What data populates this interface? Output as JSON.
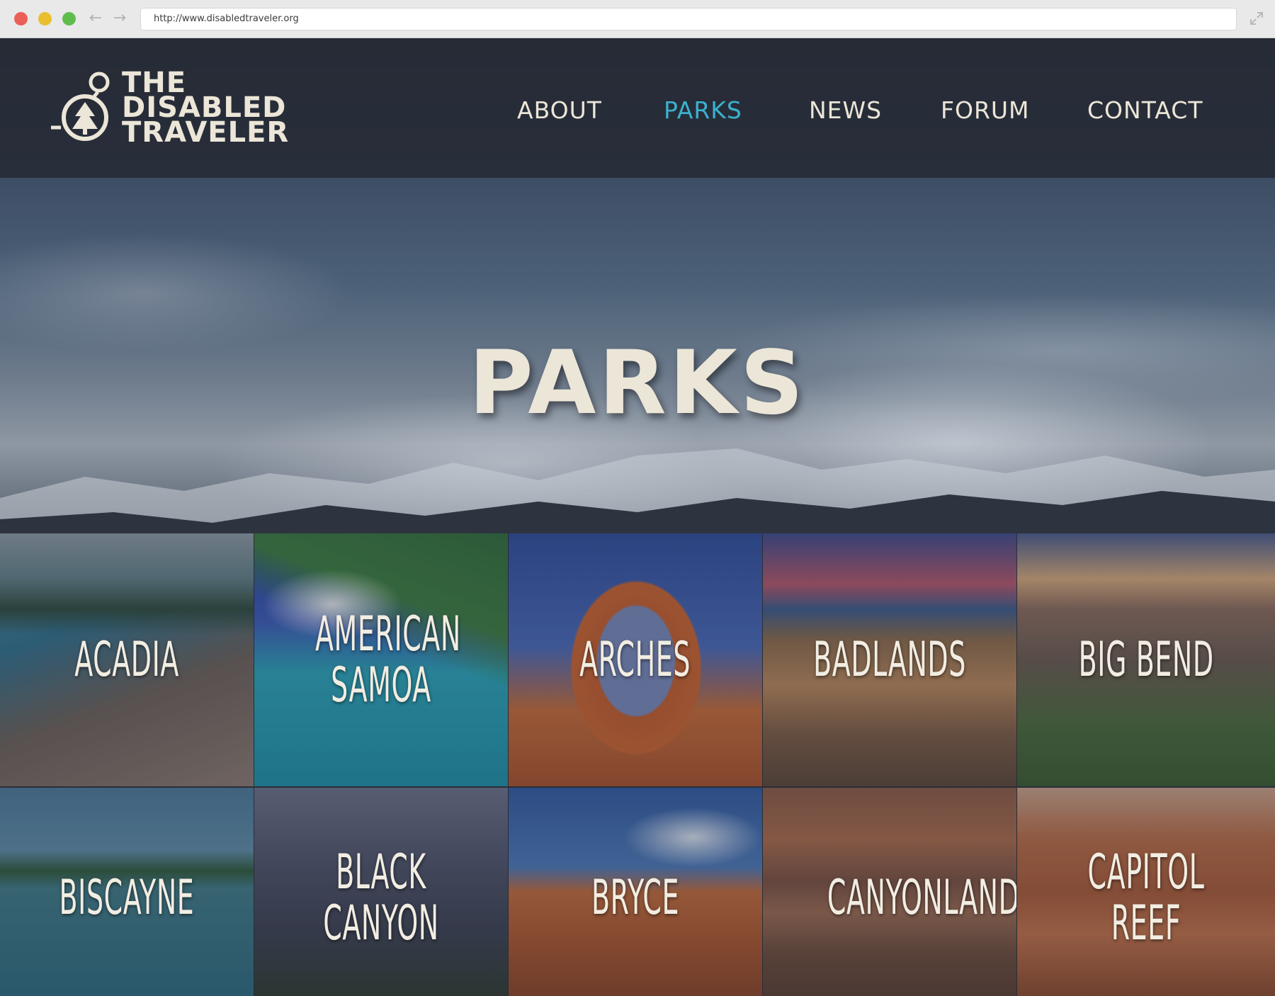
{
  "browser": {
    "url": "http://www.disabledtraveler.org"
  },
  "site": {
    "logo_lines": [
      "THE",
      "DISABLED",
      "TRAVELER"
    ]
  },
  "nav": {
    "items": [
      {
        "label": "ABOUT",
        "active": false
      },
      {
        "label": "PARKS",
        "active": true
      },
      {
        "label": "NEWS",
        "active": false
      },
      {
        "label": "FORUM",
        "active": false
      },
      {
        "label": "CONTACT",
        "active": false
      }
    ]
  },
  "hero": {
    "title": "PARKS"
  },
  "parks": [
    {
      "name": "ACADIA"
    },
    {
      "name": "AMERICAN SAMOA"
    },
    {
      "name": "ARCHES"
    },
    {
      "name": "BADLANDS"
    },
    {
      "name": "BIG BEND"
    },
    {
      "name": "BISCAYNE"
    },
    {
      "name": "BLACK CANYON"
    },
    {
      "name": "BRYCE"
    },
    {
      "name": "CANYONLANDS"
    },
    {
      "name": "CAPITOL REEF"
    }
  ],
  "colors": {
    "accent": "#3bb1cf",
    "text_light": "#ece6d8",
    "header_bg": "#262a34"
  }
}
